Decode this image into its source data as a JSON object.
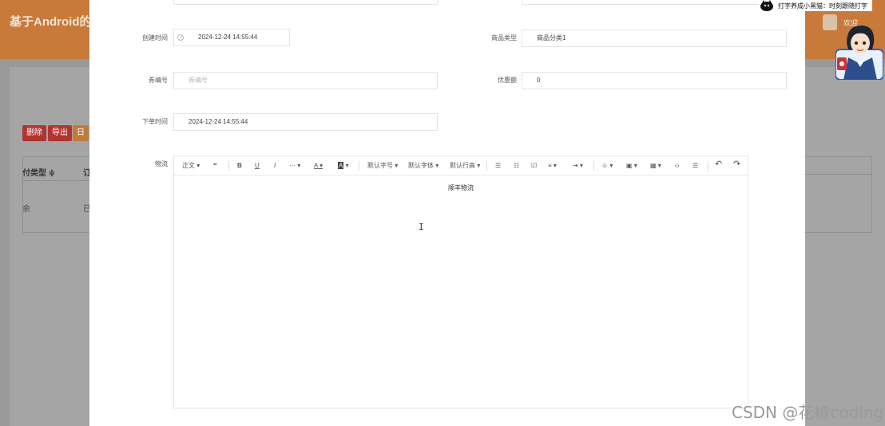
{
  "background": {
    "app_title": "基于Android的",
    "buttons": {
      "delete": "删除",
      "export": "导出",
      "other": "日"
    },
    "table": {
      "col1": "付类型 ≑",
      "col2": "订",
      "cell1": "余",
      "cell2": "已"
    },
    "welcome": "欢迎"
  },
  "overlay": {
    "typing_notice": "打字养成小黑猫：时刻跟随打字"
  },
  "form": {
    "created_time": {
      "label": "创建时间",
      "value": "2024-12-24 14:55:44"
    },
    "product_type": {
      "label": "商品类型",
      "value": "商品分类1"
    },
    "coupon_no": {
      "label": "券编号",
      "placeholder": "券编号"
    },
    "discount": {
      "label": "优惠额",
      "value": "0"
    },
    "order_time": {
      "label": "下单时间",
      "value": "2024-12-24 14:55:44"
    },
    "logistics": {
      "label": "物流"
    }
  },
  "editor": {
    "toolbar": {
      "paragraph": "正文",
      "quote": "❝",
      "bold": "B",
      "underline": "U",
      "italic": "I",
      "more": "···",
      "font_color": "A",
      "bg_color": "A",
      "font_size": "默认字号",
      "font_family": "默认字体",
      "line_height": "默认行高",
      "bullet_list": "☰",
      "numbered_list": "☷",
      "todo": "☑",
      "align": "≡",
      "indent": "⇥",
      "emoji": "☺",
      "image": "▣",
      "table": "▦",
      "code": "‹›",
      "divider": "☰",
      "undo": "↶",
      "redo": "↷"
    },
    "content": "顺丰物流"
  },
  "watermark": "CSDN @花椒coding"
}
